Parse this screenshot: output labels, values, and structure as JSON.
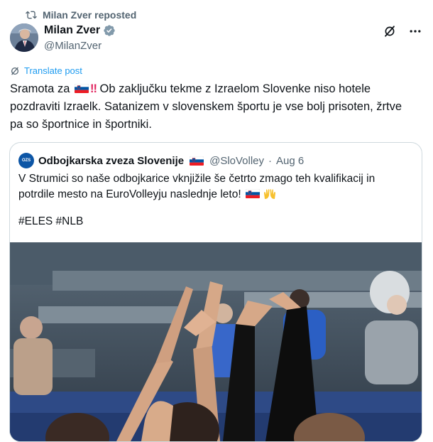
{
  "repost": {
    "label": "Milan Zver reposted"
  },
  "author": {
    "name": "Milan Zver",
    "handle": "@MilanZver"
  },
  "translate": {
    "label": "Translate post"
  },
  "tweet": {
    "part1": "Sramota za",
    "part2": " Ob zaključku tekme z Izraelom Slovenke niso hotele pozdraviti Izraelk. Satanizem v slovenskem športu je vse bolj prisoten, žrtve pa so športnice in športniki."
  },
  "quote": {
    "name": "Odbojkarska zveza Slovenije",
    "handle": "@SloVolley",
    "separator": "·",
    "date": "Aug 6",
    "avatar_text": "OZS",
    "text": "V Strumici so naše odbojkarice vknjižile še četrto zmago teh kvalifikacij in potrdile mesto na EuroVolleyju naslednje leto!",
    "hashtags": "#ELES #NLB"
  },
  "icons": {
    "repost": "repost-icon",
    "verified": "verified-badge-icon",
    "grok": "grok-icon",
    "more": "more-icon",
    "translate": "translate-icon",
    "flag": "slovenia-flag-icon",
    "double_exclamation": "double-exclamation-icon",
    "raised_hands": "raised-hands-icon"
  },
  "colors": {
    "text": "#0f1419",
    "muted": "#536471",
    "link": "#1d9bf0",
    "verified": "#829aab",
    "border": "#cfd9de"
  }
}
